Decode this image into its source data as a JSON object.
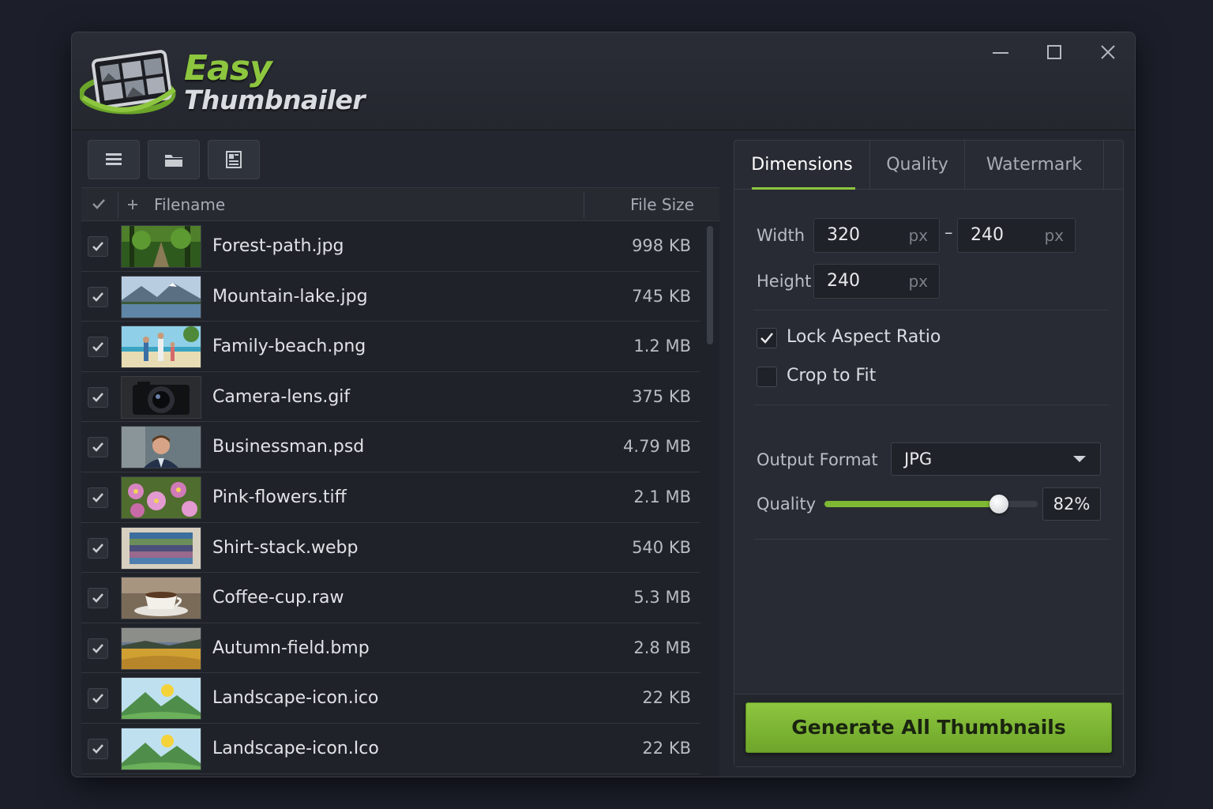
{
  "app": {
    "brand_line1": "Easy",
    "brand_line2": "Thumbnailer",
    "accent_color": "#8dc63f"
  },
  "window_controls": [
    "minimize-icon",
    "maximize-icon",
    "close-icon"
  ],
  "toolbar": {
    "buttons": [
      "list-icon",
      "folder-icon",
      "layout-icon"
    ]
  },
  "file_list": {
    "headers": {
      "filename": "Filename",
      "file_size": "File Size"
    },
    "rows": [
      {
        "name": "Forest-path.jpg",
        "size": "998 KB",
        "checked": true,
        "thumb": "forest"
      },
      {
        "name": "Mountain-lake.jpg",
        "size": "745 KB",
        "checked": true,
        "thumb": "lake"
      },
      {
        "name": "Family-beach.png",
        "size": "1.2 MB",
        "checked": true,
        "thumb": "beach"
      },
      {
        "name": "Camera-lens.gif",
        "size": "375 KB",
        "checked": true,
        "thumb": "camera"
      },
      {
        "name": "Businessman.psd",
        "size": "4.79 MB",
        "checked": true,
        "thumb": "person"
      },
      {
        "name": "Pink-flowers.tiff",
        "size": "2.1 MB",
        "checked": true,
        "thumb": "flowers"
      },
      {
        "name": "Shirt-stack.webp",
        "size": "540 KB",
        "checked": true,
        "thumb": "shirts"
      },
      {
        "name": "Coffee-cup.raw",
        "size": "5.3 MB",
        "checked": true,
        "thumb": "coffee"
      },
      {
        "name": "Autumn-field.bmp",
        "size": "2.8 MB",
        "checked": true,
        "thumb": "field"
      },
      {
        "name": "Landscape-icon.ico",
        "size": "22 KB",
        "checked": true,
        "thumb": "landscape"
      },
      {
        "name": "Landscape-icon.Ico",
        "size": "22 KB",
        "checked": true,
        "thumb": "landscape"
      }
    ]
  },
  "settings": {
    "tabs": [
      {
        "label": "Dimensions",
        "active": true
      },
      {
        "label": "Quality",
        "active": false
      },
      {
        "label": "Watermark",
        "active": false
      }
    ],
    "width_label": "Width",
    "height_label": "Height",
    "width_value": "320",
    "width_value2": "240",
    "height_value": "240",
    "unit": "px",
    "separator": "–",
    "lock_aspect_label": "Lock Aspect Ratio",
    "lock_aspect_checked": true,
    "crop_label": "Crop to Fit",
    "crop_checked": false,
    "output_format_label": "Output Format",
    "output_format_value": "JPG",
    "quality_label": "Quality",
    "quality_percent": 82,
    "quality_display": "82%",
    "generate_label": "Generate All Thumbnails"
  }
}
